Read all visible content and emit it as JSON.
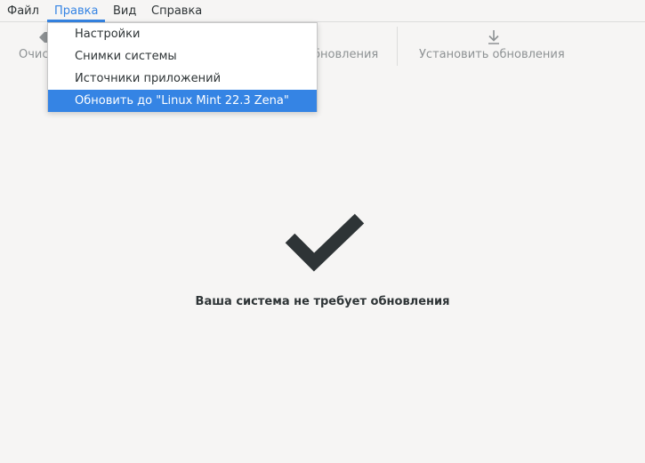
{
  "menubar": {
    "items": [
      {
        "label": "Файл"
      },
      {
        "label": "Правка"
      },
      {
        "label": "Вид"
      },
      {
        "label": "Справка"
      }
    ]
  },
  "toolbar": {
    "clear_label": "Очис",
    "refresh_label": "бновления",
    "install_label": "Установить обновления"
  },
  "edit_menu": {
    "items": [
      {
        "label": "Настройки"
      },
      {
        "label": "Снимки системы"
      },
      {
        "label": "Источники приложений"
      },
      {
        "label": "Обновить до \"Linux Mint 22.3 Zena\""
      }
    ]
  },
  "status": {
    "message": "Ваша система не требует обновления"
  },
  "colors": {
    "accent": "#3584e4",
    "background": "#f6f5f4",
    "text": "#2e3436",
    "disabled_text": "#8e9294"
  }
}
